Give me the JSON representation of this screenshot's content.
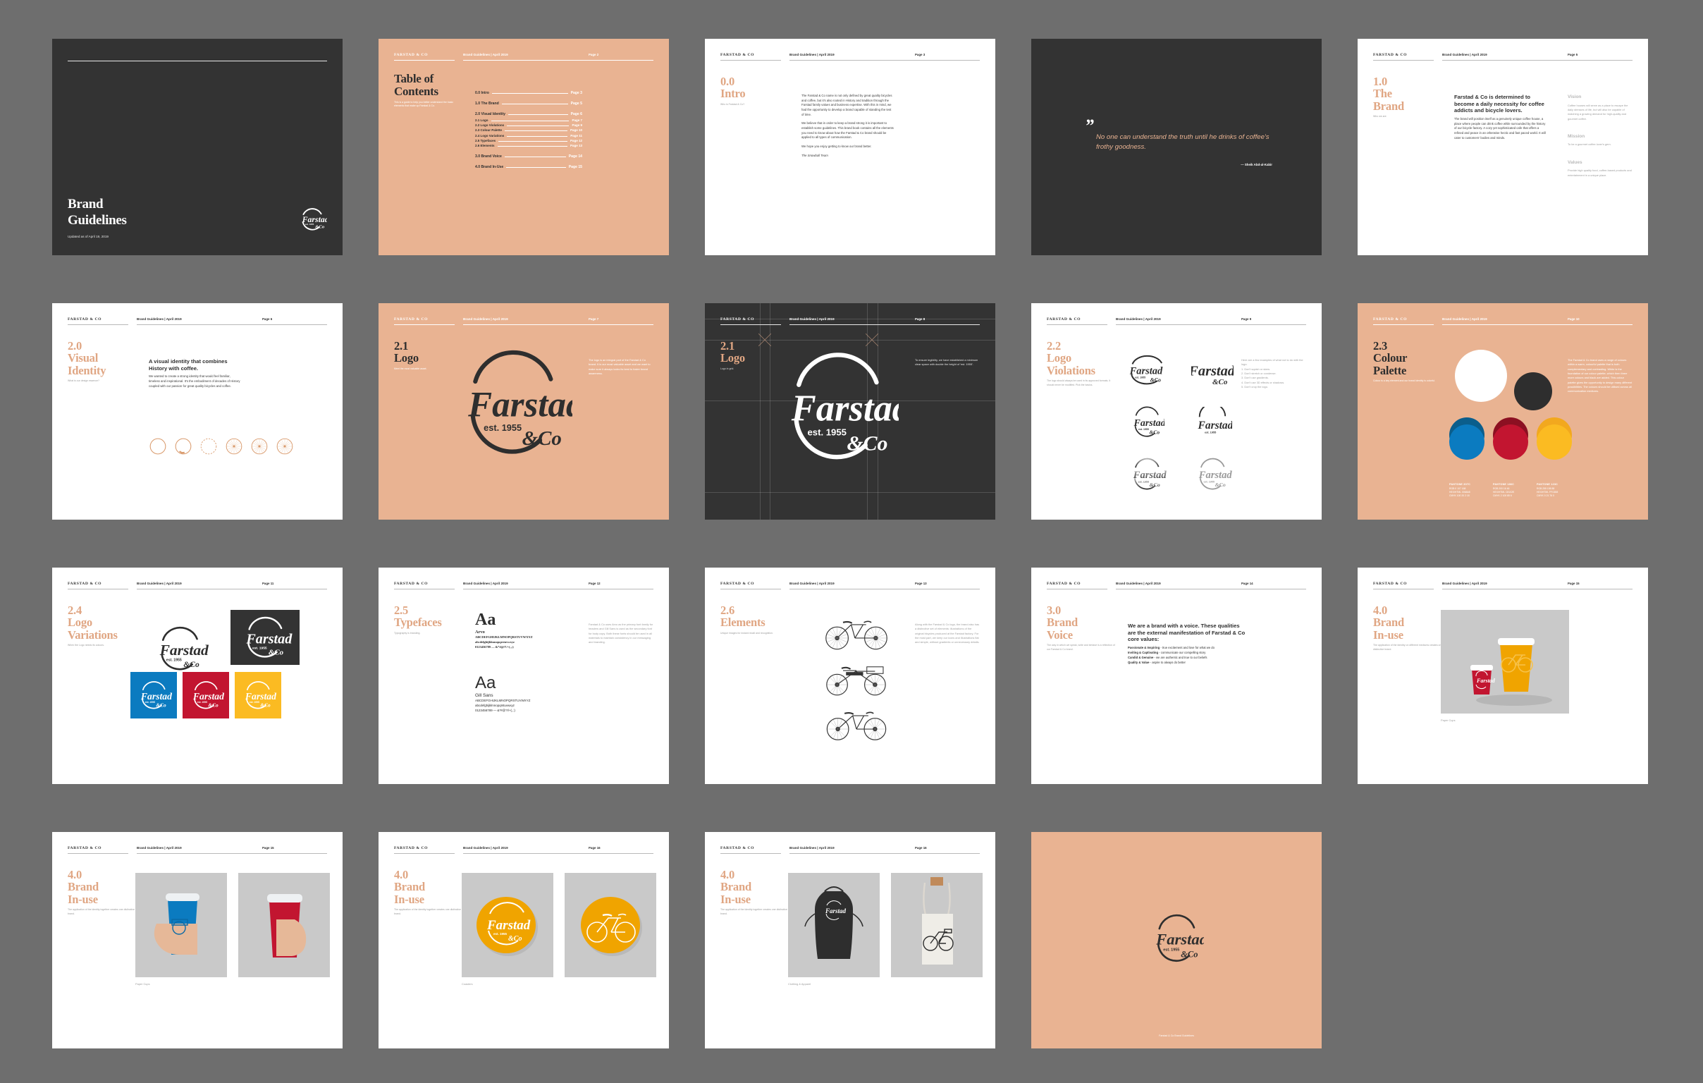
{
  "deck": {
    "brandmark": "FARSTAD & CO",
    "doc_header": "Brand Guidelines | April 2019",
    "logo": {
      "wordmark": "Farstad",
      "est": "est. 1955",
      "suffix": "& Co"
    },
    "colors": {
      "peach": "#e9b392",
      "dark": "#333333",
      "accent_text": "#e0a683",
      "blue": "#0068A8",
      "red": "#C8102E",
      "yellow": "#FFC658",
      "white": "#FFFFFF",
      "black": "#2E2E2E",
      "canvas": "#6E6E6E"
    }
  },
  "slides": {
    "cover": {
      "title_line1": "Brand",
      "title_line2": "Guidelines",
      "subtitle": "Updated as of April 19, 2019"
    },
    "toc": {
      "page": "Page 2",
      "title_line1": "Table of",
      "title_line2": "Contents",
      "blurb": "This is a guide to help you better understand the basic elements that make up Farstad & Co.",
      "entries": [
        {
          "label": "0.0 Intro",
          "page": "Page 3",
          "level": "major"
        },
        {
          "label": "1.0 The Brand",
          "page": "Page 5",
          "level": "major"
        },
        {
          "label": "2.0 Visual Identity",
          "page": "Page 6",
          "level": "major"
        },
        {
          "label": "2.1 Logo",
          "page": "Page 7",
          "level": "minor"
        },
        {
          "label": "2.2 Logo Violations",
          "page": "Page 9",
          "level": "minor"
        },
        {
          "label": "2.3 Colour Palette",
          "page": "Page 10",
          "level": "minor"
        },
        {
          "label": "2.4 Logo Variations",
          "page": "Page 11",
          "level": "minor"
        },
        {
          "label": "2.5 Typefaces",
          "page": "Page 12",
          "level": "minor"
        },
        {
          "label": "2.6 Elements",
          "page": "Page 13",
          "level": "minor"
        },
        {
          "label": "3.0 Brand Voice",
          "page": "Page 14",
          "level": "major"
        },
        {
          "label": "4.0 Brand In-Use",
          "page": "Page 15",
          "level": "major"
        }
      ]
    },
    "intro": {
      "page": "Page 3",
      "num": "0.0",
      "title": "Intro",
      "sub": "Who is Farstad & Co?",
      "p1": "The Farstad & Co name is not only defined by great quality bicycles and coffee, but it's also rooted in History and tradition through the Farstad family values and business expertise. With this in mind, we had the opportunity to develop a brand capable of standing the test of time.",
      "p2": "We believe that in order to keep a brand strong it is important to establish some guidelines. This brand book contains all the elements you need to know about how the Farstad & Co brand should be applied to all types of communication.",
      "p3": "We hope you enjoy getting to know our brand better.",
      "sig": "The Snowball Team"
    },
    "quote": {
      "mark": "”",
      "text": "No one can understand the truth until he drinks of coffee's frothy goodness.",
      "attribution": "— Sheik Abd-al-Kabir"
    },
    "brand": {
      "page": "Page 5",
      "num": "1.0",
      "title_line1": "The",
      "title_line2": "Brand",
      "sub": "Who we are",
      "headline": "Farstad & Co is determined to become a daily necessity for coffee addicts and bicycle lovers.",
      "body": "The brand will position itself as a genuinely unique coffee house, a place where people can drink coffee while surrounded by the history of our bicycle factory. A cozy yet sophisticated cafe that offers a refined and peace in an otherwise hectic and fast paced world. It will cater to customers' bodies and minds.",
      "vision_label": "Vision",
      "vision_text": "Coffee houses will serve as a place to escape the daily stresses of life, but will also be capable of matching a growing demand for high-quality and gourmet coffee.",
      "mission_label": "Mission",
      "mission_text": "To be a gourmet coffee lover's gem.",
      "values_label": "Values",
      "values_text": "Provide high quality food, coffee-based products and entertainment in a unique place."
    },
    "visual_identity": {
      "page": "Page 6",
      "num": "2.0",
      "title_line1": "Visual",
      "title_line2": "Identity",
      "sub": "What is our design essence?",
      "headline": "A visual identity that combines History with coffee.",
      "body": "We wanted to create a strong identity that would feel familiar, timeless and inspirational. It's the embodiment of decades of History coupled with our passion for great quality bicycles and coffee."
    },
    "logo_peach": {
      "page": "Page 7",
      "num": "2.1",
      "title": "Logo",
      "sub": "Meet the most valuable asset.",
      "note": "The logo is an integral part of the Farstad & Co brand. It is our most valuable asset and we want to make sure it always looks its best to foster brand awareness."
    },
    "logo_grid": {
      "page": "Page 8",
      "num": "2.1",
      "title": "Logo",
      "sub": "Logo in grid.",
      "note": "To ensure legibility, we have established a minimum clear space with double the height of 'est. 1955'."
    },
    "logo_violations": {
      "page": "Page 9",
      "num": "2.2",
      "title_line1": "Logo",
      "title_line2": "Violations",
      "sub": "The logo should always be used in its approved formats. It should never be modified. Pick the basics.",
      "note_intro": "Here are a few examples of what not to do with the logo:",
      "rules": [
        "1. Don't squish or skew.",
        "2. Don't stretch or condense.",
        "3. Don't use gradients.",
        "4. Don't use 3D effects or shadows.",
        "5. Don't crop the logo."
      ]
    },
    "colour_palette": {
      "page": "Page 10",
      "num": "2.3",
      "title_line1": "Colour",
      "title_line2": "Palette",
      "sub": "Colour is a key element and our brand identity is colorful.",
      "note": "The Farstad & Co brand uses a range of colours within a warm, colourful palette that is both complementary and contrasting. White is the foundation of our colour palette, which then three more colours and black are added. This colour palette gives the opportunity to design many different possibilities. The colours should be utilised across all communication mediums.",
      "swatches": [
        {
          "pantone": "PANTONE 307C",
          "rgb": "RGB 0 107 168",
          "hex": "HEX/HTML 0068A8",
          "cmyk": "CMYK 100 20 2 18",
          "color": "#0068A8"
        },
        {
          "pantone": "PANTONE 186C",
          "rgb": "RGB 200 16 46",
          "hex": "HEX/HTML C8102E",
          "cmyk": "CMYK 2 100 85 6",
          "color": "#C8102E"
        },
        {
          "pantone": "PANTONE 123C",
          "rgb": "RGB 255 198 88",
          "hex": "HEX/HTML FFC658",
          "cmyk": "CMYK 0 21 76 0",
          "color": "#FFC658"
        }
      ]
    },
    "logo_variations": {
      "page": "Page 11",
      "num": "2.4",
      "title_line1": "Logo",
      "title_line2": "Variations",
      "sub": "When the Logo needs its colours."
    },
    "typefaces": {
      "page": "Page 12",
      "num": "2.5",
      "title": "Typefaces",
      "sub": "Typography is branding.",
      "note": "Farstad & Co uses Arvo as the primary font family for headers and Gill Sans is used as the secondary font for body copy. Both these fonts should be used in all materials to maintain consistency in our messaging and branding.",
      "primary": {
        "sample": "Aa",
        "name": "Arvo",
        "upper": "ABCDEFGHIJKLMNOPQRSTUVWXYZ",
        "lower": "abcdefghijklmnopqrstuvwxyz",
        "figures": "0123456789 — &*#@?!/+(.,:)"
      },
      "secondary": {
        "sample": "Aa",
        "name": "Gill Sans",
        "upper": "ABCDEFGHIJKLMNOPQRSTUVWXYZ",
        "lower": "abcdefghijklmnopqrstuvwxyz",
        "figures": "0123456789 — &*#@?!/+(.,:)"
      }
    },
    "elements": {
      "page": "Page 13",
      "num": "2.6",
      "title": "Elements",
      "sub": "Unique images for instant recall and recognition.",
      "note": "Along with the Farstad & Co logo, the brand also has a distinctive set of elements: illustrations of the original bicycles produced at the Farstad factory. For the most part, we keep our icons and illustrations flat and simple, without gradients or unnecessary details."
    },
    "brand_voice": {
      "page": "Page 14",
      "num": "3.0",
      "title_line1": "Brand",
      "title_line2": "Voice",
      "sub": "The way in which we speak, write and behave is a reflection of our Farstad & Co brand.",
      "headline": "We are a brand with a voice. These qualities are the external manifestation of Farstad & Co core values:",
      "values": [
        {
          "label": "Passionate & Inspiring",
          "text": " - true excitement and love for what we do"
        },
        {
          "label": "Inviting & Captivating",
          "text": " - communicate our compelling story"
        },
        {
          "label": "Candid & Genuine",
          "text": " - we are authentic and true to our beliefs"
        },
        {
          "label": "Quality & Value",
          "text": " - aspire to always do better"
        }
      ]
    },
    "inuse_cups_mockup": {
      "page": "Page 15",
      "num": "4.0",
      "title_line1": "Brand",
      "title_line2": "In-use",
      "sub": "The application of the identity on different mediums creates one distinctive brand.",
      "caption": "Paper Cups"
    },
    "inuse_cups_hands": {
      "page": "Page 15",
      "num": "4.0",
      "title_line1": "Brand",
      "title_line2": "In-use",
      "sub": "The application of the identity together creates one distinctive brand.",
      "caption": "Paper Cups"
    },
    "inuse_coasters": {
      "page": "Page 16",
      "num": "4.0",
      "title_line1": "Brand",
      "title_line2": "In-use",
      "sub": "The application of the identity together creates one distinctive brand.",
      "caption": "Coasters"
    },
    "inuse_apparel": {
      "page": "Page 16",
      "num": "4.0",
      "title_line1": "Brand",
      "title_line2": "In-use",
      "sub": "The application of the identity together creates one distinctive brand.",
      "caption": "Clothing & Apparel"
    },
    "end": {
      "caption": "Farstad & Co Brand Guidelines"
    }
  }
}
